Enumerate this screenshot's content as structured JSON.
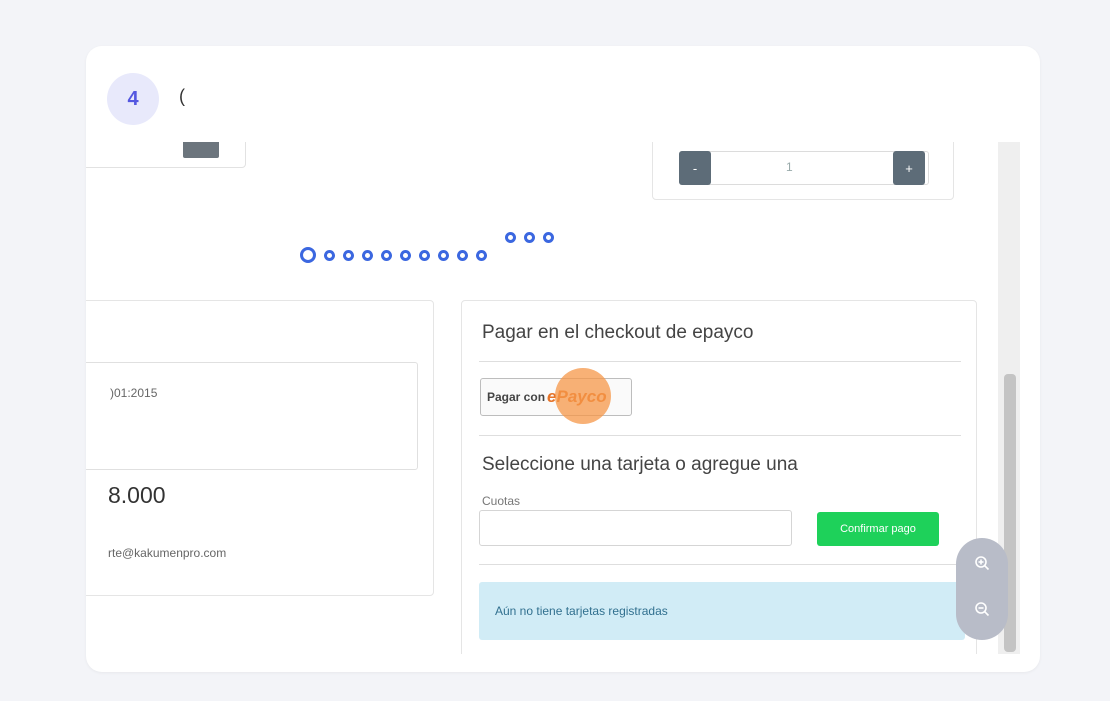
{
  "step": {
    "number": "4",
    "text": "("
  },
  "product": {
    "quantity": "1",
    "minus_label": "-",
    "plus_label": "+"
  },
  "left_panel": {
    "cert_text": ")01:2015",
    "price": "8.000",
    "email": "rte@kakumenpro.com"
  },
  "checkout": {
    "title": "Pagar en el checkout de epayco",
    "epayco_prefix": "Pagar con",
    "epayco_brand": "ePayco",
    "card_title": "Seleccione una tarjeta o agregue una",
    "cuotas_label": "Cuotas",
    "cuotas_value": "",
    "confirm_label": "Confirmar pago",
    "no_cards_alert": "Aún no tiene tarjetas registradas"
  },
  "colors": {
    "accent": "#3b67e0",
    "confirm_green": "#1ed15a",
    "highlight": "#f69748",
    "step_badge_text": "#5457e0"
  },
  "icons": {
    "zoom_in": "zoom-in-icon",
    "zoom_out": "zoom-out-icon"
  }
}
